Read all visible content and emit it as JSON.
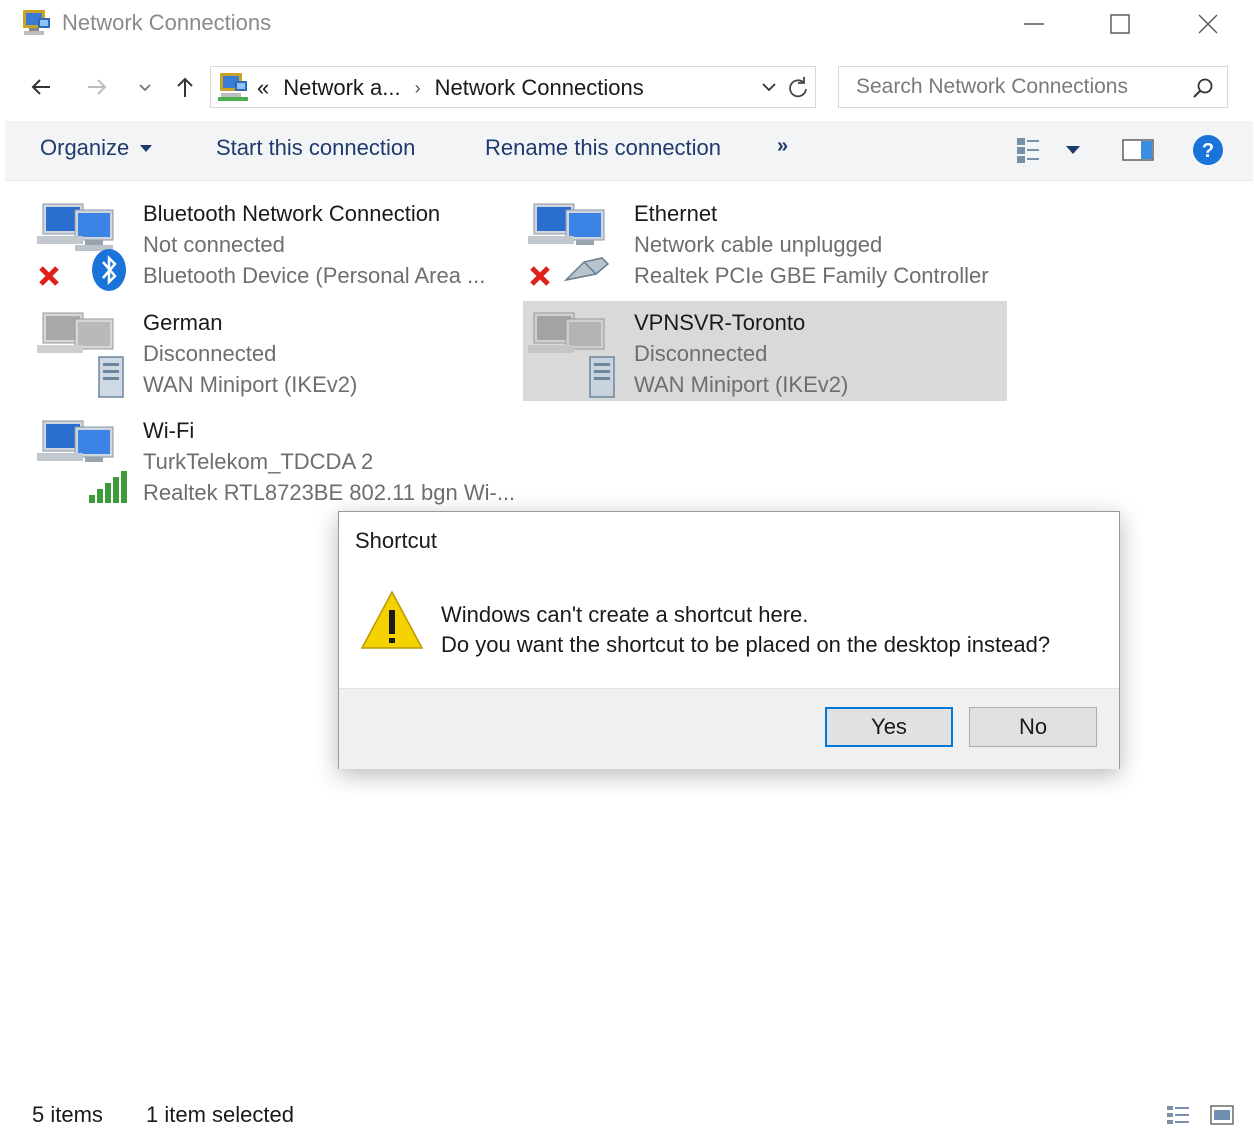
{
  "window": {
    "title": "Network Connections",
    "controls": {
      "minimize": "minimize",
      "maximize": "maximize",
      "close": "close"
    }
  },
  "address": {
    "overflow": "«",
    "crumbs": [
      "Network a...",
      "Network Connections"
    ],
    "search_placeholder": "Search Network Connections"
  },
  "toolbar": {
    "organize": "Organize",
    "start": "Start this connection",
    "rename": "Rename this connection",
    "more": "»"
  },
  "connections": [
    {
      "name": "Bluetooth Network Connection",
      "status": "Not connected",
      "device": "Bluetooth Device (Personal Area ...",
      "icon": "bluetooth-network-icon",
      "badge": "red-x",
      "selected": false
    },
    {
      "name": "Ethernet",
      "status": "Network cable unplugged",
      "device": "Realtek PCIe GBE Family Controller",
      "icon": "ethernet-network-icon",
      "badge": "red-x",
      "selected": false
    },
    {
      "name": "German",
      "status": "Disconnected",
      "device": "WAN Miniport (IKEv2)",
      "icon": "vpn-network-icon",
      "badge": "none",
      "selected": false
    },
    {
      "name": "VPNSVR-Toronto",
      "status": "Disconnected",
      "device": "WAN Miniport (IKEv2)",
      "icon": "vpn-network-icon",
      "badge": "none",
      "selected": true
    },
    {
      "name": "Wi-Fi",
      "status": "TurkTelekom_TDCDA 2",
      "device": "Realtek RTL8723BE 802.11 bgn Wi-...",
      "icon": "wifi-network-icon",
      "badge": "signal-bars",
      "selected": false
    }
  ],
  "dialog": {
    "title": "Shortcut",
    "line1": "Windows can't create a shortcut here.",
    "line2": "Do you want the shortcut to be placed on the desktop instead?",
    "yes": "Yes",
    "no": "No"
  },
  "statusbar": {
    "count": "5 items",
    "selected": "1 item selected"
  },
  "colors": {
    "accent": "#0078d7",
    "selection": "#d9d9d9",
    "command_text": "#1e3a6e",
    "command_bar_bg": "#f3f4f6",
    "error_red": "#e0201b",
    "bluetooth_blue": "#1a73d9",
    "warning_yellow": "#f5d100"
  }
}
